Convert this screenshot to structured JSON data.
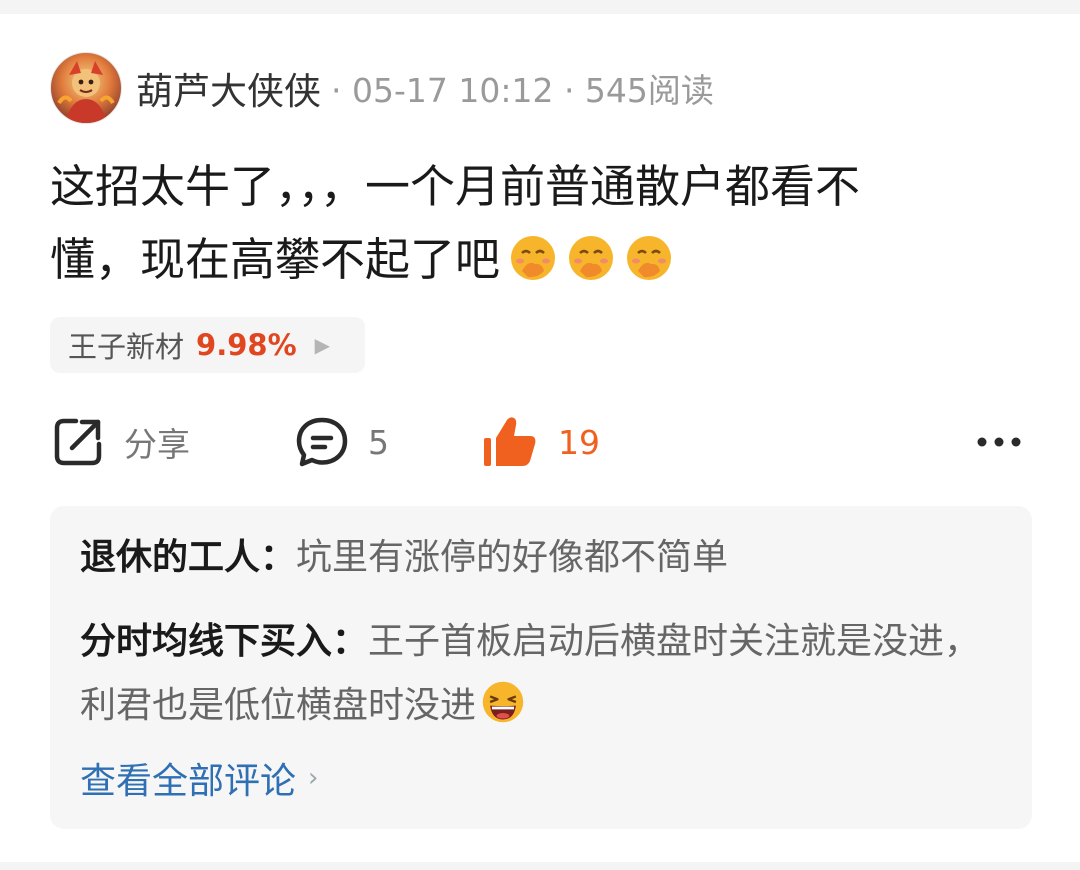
{
  "post": {
    "author": "葫芦大侠侠",
    "meta": "· 05-17 10:12 · 545阅读",
    "body_line1": "这招太牛了，，，一个月前普通散户都看不",
    "body_line2": "懂，现在高攀不起了吧",
    "emojis": [
      "hand-over-mouth-emoji",
      "hand-over-mouth-emoji",
      "hand-over-mouth-emoji"
    ]
  },
  "stock": {
    "name": "王子新材",
    "change": "9.98%",
    "arrow": "▶",
    "change_color": "#e0461f"
  },
  "actions": {
    "share_label": "分享",
    "comment_count": "5",
    "like_count": "19",
    "like_color": "#f0601f"
  },
  "comments": [
    {
      "author": "退休的工人：",
      "text": "坑里有涨停的好像都不简单"
    },
    {
      "author": "分时均线下买入：",
      "text": "王子首板启动后横盘时关注就是没进，利君也是低位横盘时没进"
    }
  ],
  "view_all": {
    "label": "查看全部评论",
    "chevron": "›"
  }
}
